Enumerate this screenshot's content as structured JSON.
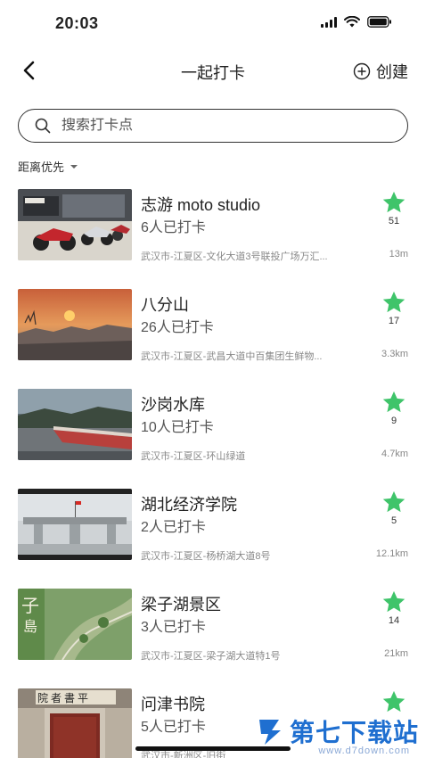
{
  "status_bar": {
    "time": "20:03"
  },
  "nav": {
    "title": "一起打卡",
    "create_label": "创建"
  },
  "search": {
    "placeholder": "搜索打卡点"
  },
  "sort": {
    "label": "距离优先"
  },
  "colors": {
    "star": "#3fc46a",
    "watermark": "#1f6fd0"
  },
  "items": [
    {
      "name": "志游 moto studio",
      "checkins": "6人已打卡",
      "address": "武汉市-江夏区-文化大道3号联投广场万汇...",
      "distance": "13m",
      "stars": "51"
    },
    {
      "name": "八分山",
      "checkins": "26人已打卡",
      "address": "武汉市-江夏区-武昌大道中百集团生鲜物...",
      "distance": "3.3km",
      "stars": "17"
    },
    {
      "name": "沙岗水库",
      "checkins": "10人已打卡",
      "address": "武汉市-江夏区-环山绿道",
      "distance": "4.7km",
      "stars": "9"
    },
    {
      "name": "湖北经济学院",
      "checkins": "2人已打卡",
      "address": "武汉市-江夏区-杨桥湖大道8号",
      "distance": "12.1km",
      "stars": "5"
    },
    {
      "name": "梁子湖景区",
      "checkins": "3人已打卡",
      "address": "武汉市-江夏区-梁子湖大道特1号",
      "distance": "21km",
      "stars": "14"
    },
    {
      "name": "问津书院",
      "checkins": "5人已打卡",
      "address": "武汉市-新洲区-旧街",
      "distance": "",
      "stars": ""
    }
  ],
  "watermark": {
    "text": "第七下载站",
    "url": "www.d7down.com"
  }
}
